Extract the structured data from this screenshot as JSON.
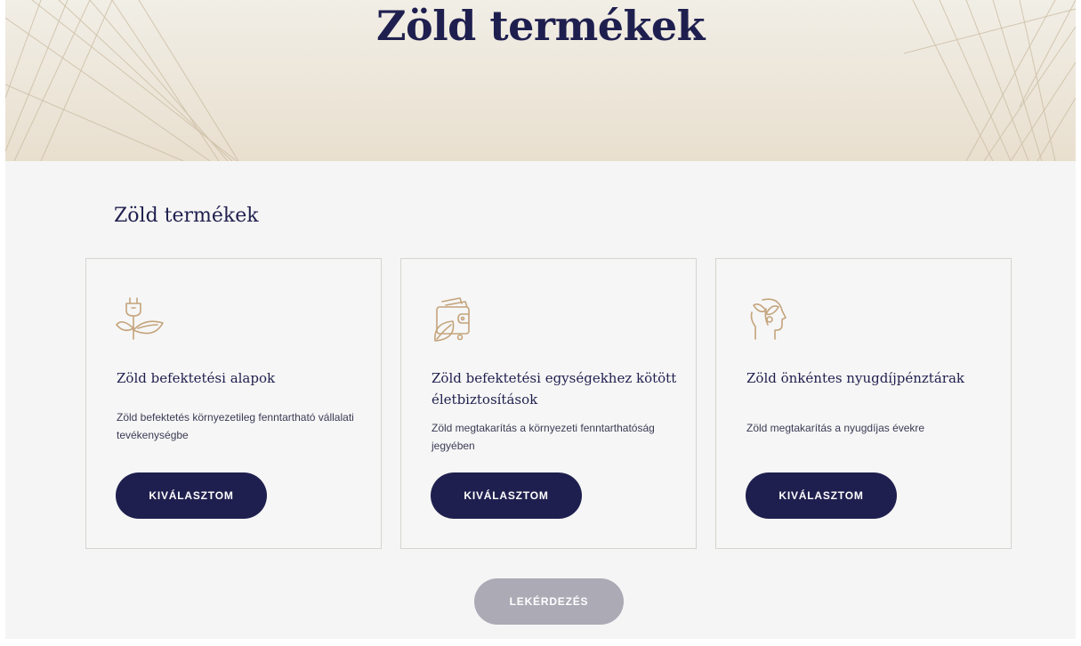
{
  "hero": {
    "title": "Zöld termékek"
  },
  "section": {
    "title": "Zöld termékek"
  },
  "cards": [
    {
      "icon": "plug-plant-icon",
      "title": "Zöld befektetési alapok",
      "description": "Zöld befektetés környezetileg fenntartható vállalati tevékenységbe",
      "button": "KIVÁLASZTOM"
    },
    {
      "icon": "wallet-leaf-icon",
      "title": "Zöld befektetési egységekhez kötött életbiztosítások",
      "description": "Zöld megtakarítás a környezeti fenntarthatóság jegyében",
      "button": "KIVÁLASZTOM"
    },
    {
      "icon": "head-leaf-icon",
      "title": "Zöld önkéntes nyugdíjpénztárak",
      "description": "Zöld megtakarítás a nyugdíjas évekre",
      "button": "KIVÁLASZTOM"
    }
  ],
  "footer": {
    "query_button": "LEKÉRDEZÉS"
  },
  "colors": {
    "primary": "#1f1f4f",
    "icon_gold": "#c4a47c",
    "disabled": "#acaab5",
    "hero_bg": "#ece5d8",
    "page_bg": "#f5f5f5"
  }
}
